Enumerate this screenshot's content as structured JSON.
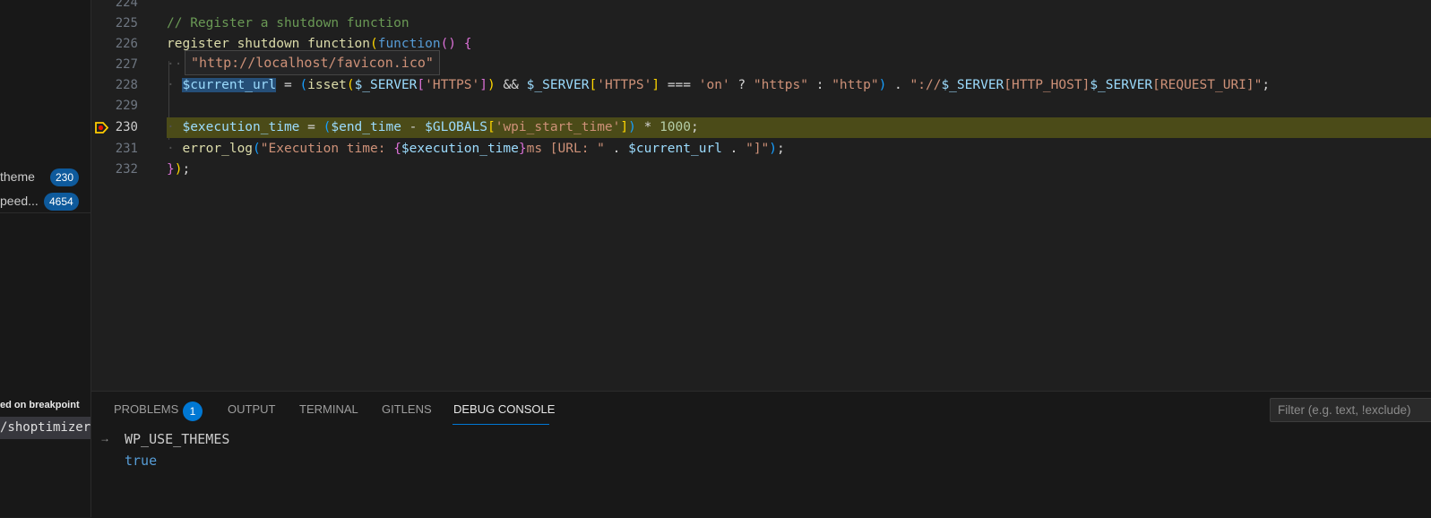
{
  "sidebar": {
    "rows": [
      {
        "label": "theme",
        "badge": "230"
      },
      {
        "label": "peed...",
        "badge": "4654"
      }
    ],
    "callstack": {
      "status": "ed on breakpoint",
      "frame": "/shoptimizer"
    }
  },
  "editor": {
    "lines": [
      {
        "n": "224"
      },
      {
        "n": "225"
      },
      {
        "n": "226"
      },
      {
        "n": "227"
      },
      {
        "n": "228"
      },
      {
        "n": "229"
      },
      {
        "n": "230"
      },
      {
        "n": "231"
      },
      {
        "n": "232"
      }
    ],
    "code": {
      "l225_comment": "// Register a shutdown function",
      "l226_fn": "register_shutdown_function",
      "l226_kw": "function",
      "l228_var1": "$current_url",
      "l228_isset": "isset",
      "l228_server1": "$_SERVER",
      "l228_https1": "'HTTPS'",
      "l228_server2": "$_SERVER",
      "l228_https2": "'HTTPS'",
      "l228_on": "'on'",
      "l228_s_https": "\"https\"",
      "l228_s_http": "\"http\"",
      "l228_sep": "\"://",
      "l228_server3": "$_SERVER",
      "l228_key3": "[HTTP_HOST]",
      "l228_server4": "$_SERVER",
      "l228_key4": "[REQUEST_URI]",
      "l228_end": "\"",
      "l230_var": "$execution_time",
      "l230_end": "$end_time",
      "l230_globals": "$GLOBALS",
      "l230_key": "'wpi_start_time'",
      "l230_num": "1000",
      "l231_fn": "error_log",
      "l231_str1": "\"Execution time: ",
      "l231_var": "$execution_time",
      "l231_str2": "ms [URL: \"",
      "l231_var2": "$current_url",
      "l231_str3": "\"]\""
    },
    "hover_value": "\"http://localhost/favicon.ico\""
  },
  "panel": {
    "tabs": [
      {
        "label": "PROBLEMS",
        "badge": "1"
      },
      {
        "label": "OUTPUT"
      },
      {
        "label": "TERMINAL"
      },
      {
        "label": "GITLENS"
      },
      {
        "label": "DEBUG CONSOLE"
      }
    ],
    "filter_placeholder": "Filter (e.g. text, !exclude)",
    "console": {
      "arrow": "→",
      "expression": "WP_USE_THEMES",
      "result": "true"
    }
  },
  "colors": {
    "breakpoint_highlight": "#4b4b18",
    "accent": "#0078d4",
    "badge": "#0e5a9c"
  }
}
